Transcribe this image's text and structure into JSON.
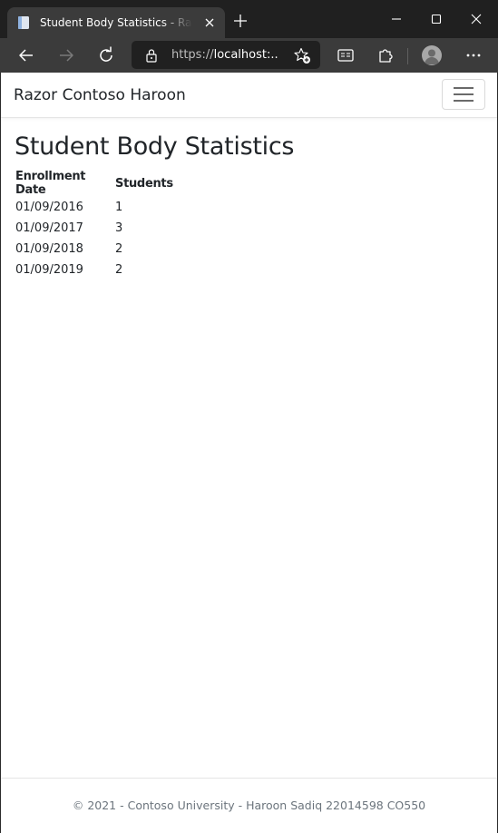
{
  "browser": {
    "tab_title": "Student Body Statistics - Razor Contoso Haroon",
    "url_prefix": "https://",
    "url_host": "localhost:...",
    "icons": {
      "favicon": "page-icon",
      "close_tab": "close-icon",
      "new_tab": "plus-icon",
      "back": "arrow-left-icon",
      "forward": "arrow-right-icon",
      "refresh": "refresh-icon",
      "lock": "lock-icon",
      "favorites": "star-add-icon",
      "reader": "immersive-reader-icon",
      "extensions": "puzzle-icon",
      "profile": "avatar-icon",
      "menu": "more-icon"
    }
  },
  "navbar": {
    "brand": "Razor Contoso Haroon",
    "toggler_icon": "hamburger-icon"
  },
  "main": {
    "title": "Student Body Statistics",
    "table": {
      "headers": [
        "Enrollment Date",
        "Students"
      ],
      "rows": [
        {
          "date": "01/09/2016",
          "students": "1"
        },
        {
          "date": "01/09/2017",
          "students": "3"
        },
        {
          "date": "01/09/2018",
          "students": "2"
        },
        {
          "date": "01/09/2019",
          "students": "2"
        }
      ]
    }
  },
  "footer": {
    "text": "© 2021 - Contoso University - Haroon Sadiq 22014598 CO550"
  },
  "colors": {
    "chrome_dark": "#202020",
    "chrome_tab": "#3b3b3b",
    "text": "#212529",
    "footer_text": "#6c757d"
  }
}
